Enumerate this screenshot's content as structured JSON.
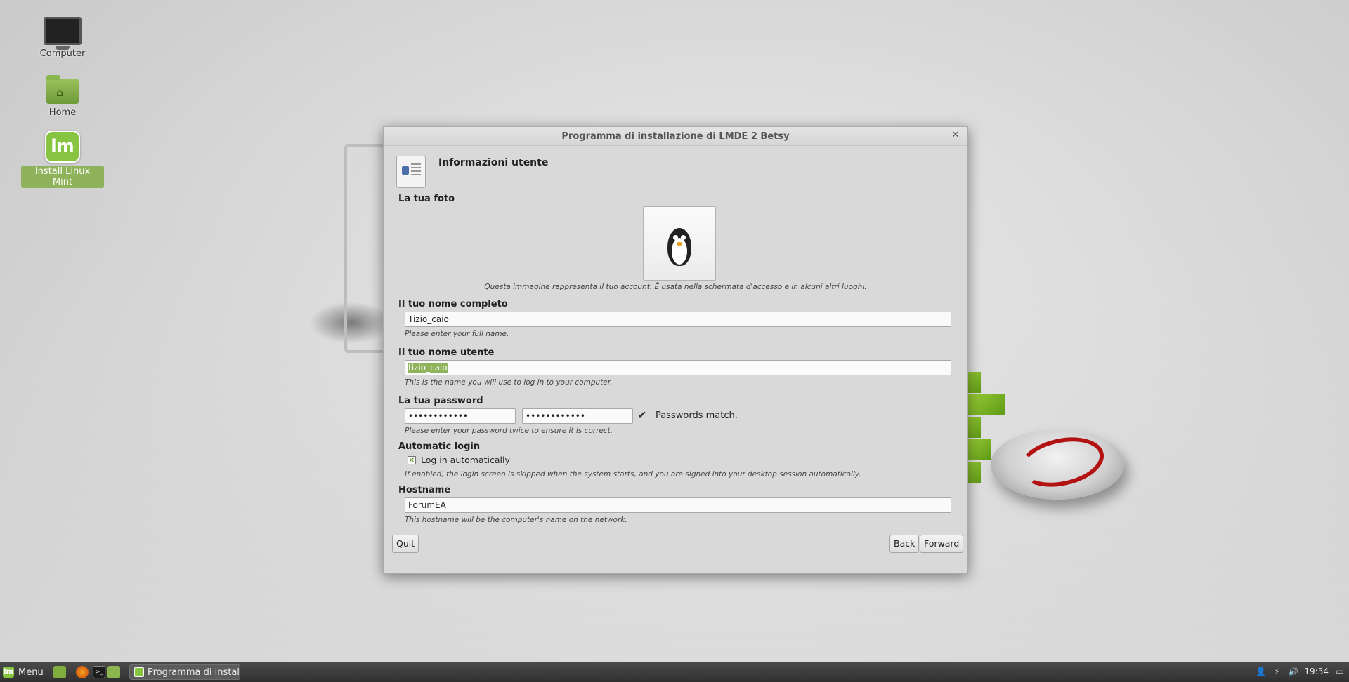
{
  "desktop": {
    "icons": [
      {
        "label": "Computer"
      },
      {
        "label": "Home"
      },
      {
        "label": "Install Linux Mint"
      }
    ]
  },
  "window": {
    "title": "Programma di installazione di LMDE 2 Betsy",
    "header_title": "Informazioni utente",
    "photo": {
      "label": "La tua foto",
      "caption": "Questa immagine rappresenta il tuo account. È usata nella schermata d'accesso e in alcuni altri luoghi."
    },
    "full_name": {
      "label": "Il tuo nome completo",
      "value": "Tizio_caio",
      "hint": "Please enter your full name."
    },
    "username": {
      "label": "Il tuo nome utente",
      "value": "tizio_caio",
      "hint": "This is the name you will use to log in to your computer."
    },
    "password": {
      "label": "La tua password",
      "value1": "••••••••••••",
      "value2": "••••••••••••",
      "status": "Passwords match.",
      "hint": "Please enter your password twice to ensure it is correct."
    },
    "autologin": {
      "label": "Automatic login",
      "checkbox_label": "Log in automatically",
      "checked": true,
      "hint": "If enabled, the login screen is skipped when the system starts, and you are signed into your desktop session automatically."
    },
    "hostname": {
      "label": "Hostname",
      "value": "ForumEA",
      "hint": "This hostname will be the computer's name on the network."
    },
    "buttons": {
      "quit": "Quit",
      "back": "Back",
      "forward": "Forward"
    }
  },
  "taskbar": {
    "menu_label": "Menu",
    "task_label": "Programma di install...",
    "clock": "19:34"
  },
  "colors": {
    "accent_green": "#87c441",
    "selection_green": "#8fb35a"
  }
}
